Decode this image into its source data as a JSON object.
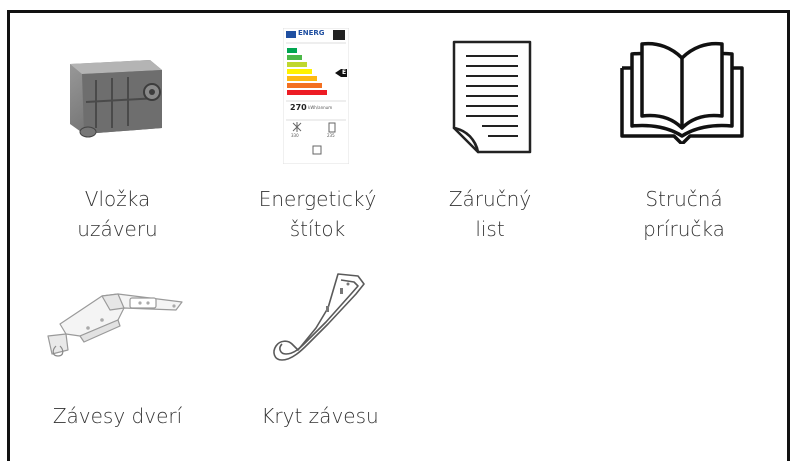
{
  "items": [
    {
      "label_lines": [
        "Vložka",
        "uzáveru"
      ],
      "icon": "closure-insert-icon"
    },
    {
      "label_lines": [
        "Energetický",
        "štítok"
      ],
      "icon": "energy-label-icon",
      "energy_label": {
        "header": "ENERG",
        "class_letter": "E",
        "consumption": "270",
        "unit": "kWh/annum",
        "freezer_l": "330",
        "fridge_l": "235"
      }
    },
    {
      "label_lines": [
        "Záručný",
        "list"
      ],
      "icon": "warranty-document-icon"
    },
    {
      "label_lines": [
        "Stručná",
        "príručka"
      ],
      "icon": "open-book-icon"
    },
    {
      "label_lines": [
        "Závesy dverí"
      ],
      "icon": "door-hinge-icon"
    },
    {
      "label_lines": [
        "Kryt závesu"
      ],
      "icon": "hinge-cover-icon"
    }
  ],
  "colors": {
    "frame": "#111111",
    "text": "#333333",
    "energy_bars": [
      "#00a651",
      "#4cb848",
      "#bfd730",
      "#fff200",
      "#fdb913",
      "#f37021",
      "#ed1c24"
    ],
    "eu_blue": "#1f4fa1"
  }
}
